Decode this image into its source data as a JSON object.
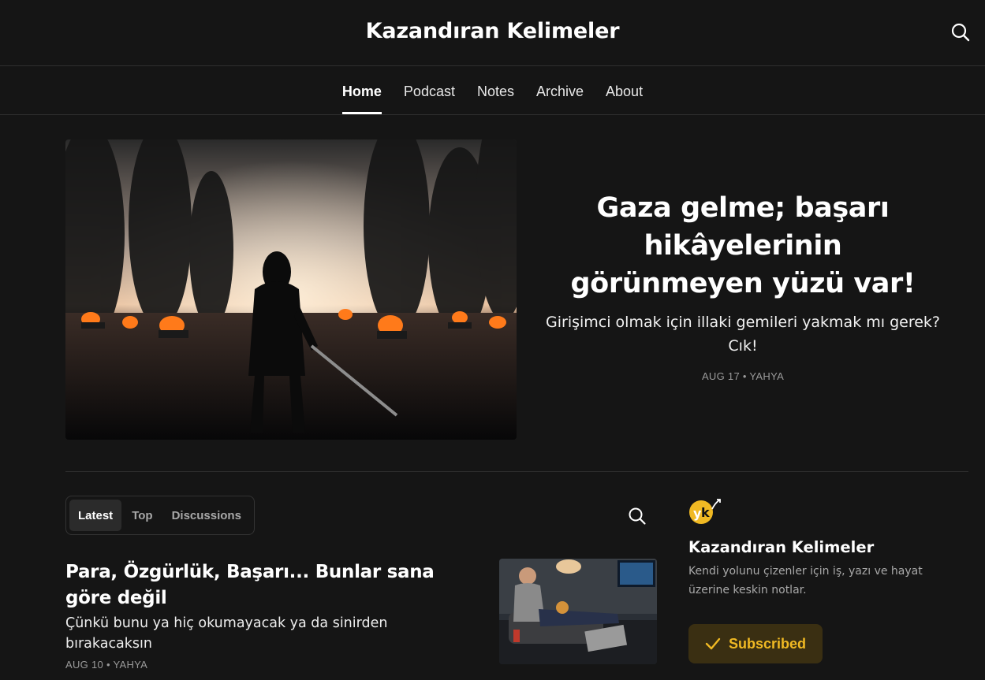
{
  "header": {
    "site_title": "Kazandıran Kelimeler"
  },
  "nav": {
    "items": [
      "Home",
      "Podcast",
      "Notes",
      "Archive",
      "About"
    ],
    "active": "Home"
  },
  "hero": {
    "title": "Gaza gelme; başarı hikâyelerinin görünmeyen yüzü var!",
    "subtitle": "Girişimci olmak için illaki gemileri yakmak mı gerek? Cık!",
    "date": "AUG 17",
    "author": "YAHYA",
    "meta": "AUG 17 • YAHYA"
  },
  "tabs": {
    "items": [
      "Latest",
      "Top",
      "Discussions"
    ],
    "active": "Latest"
  },
  "post": {
    "title": "Para, Özgürlük, Başarı... Bunlar sana göre değil",
    "subtitle": "Çünkü bunu ya hiç okumayacak ya da sinirden bırakacaksın",
    "meta": "AUG 10 • YAHYA"
  },
  "sidebar": {
    "title": "Kazandıran Kelimeler",
    "description": "Kendi yolunu çizenler için iş, yazı ve hayat üzerine keskin notlar.",
    "subscribe_label": "Subscribed"
  },
  "icons": {
    "search": "search-icon",
    "check": "check-icon",
    "logo": "publication-logo"
  },
  "colors": {
    "background": "#151515",
    "accent": "#f0b923",
    "subscribed_bg": "#3a2f12"
  }
}
